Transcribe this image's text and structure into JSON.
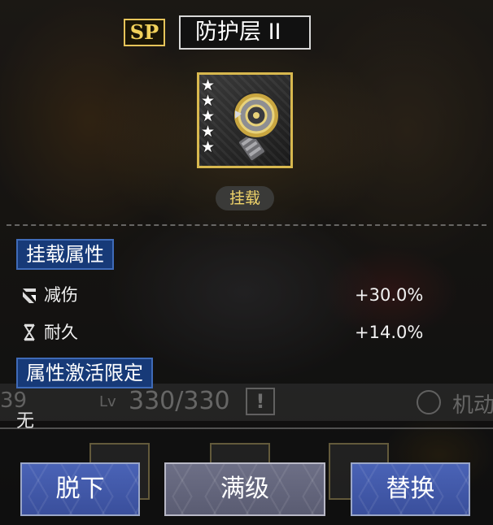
{
  "header": {
    "rarity_badge": "SP",
    "item_name": "防护层 II"
  },
  "item": {
    "star_count": 5,
    "icon": "shield-gear-icon",
    "slot_tag": "挂载"
  },
  "attributes_section": {
    "title": "挂载属性",
    "rows": [
      {
        "icon": "damage-reduction-icon",
        "label": "减伤",
        "value": "+30.0%"
      },
      {
        "icon": "hourglass-icon",
        "label": "耐久",
        "value": "+14.0%"
      }
    ]
  },
  "activation_section": {
    "title": "属性激活限定",
    "value": "无"
  },
  "background_strip": {
    "left_number": "39",
    "level_prefix": "Lv",
    "level": "330/330",
    "warning": "!",
    "mobility_label": "机动"
  },
  "buttons": {
    "unequip": "脱下",
    "max_level": "满级",
    "replace": "替换"
  },
  "colors": {
    "gold": "#e6c45a",
    "section_blue": "#173a78",
    "button_blue": "#4a63b6",
    "button_gray": "#6d6f86"
  }
}
